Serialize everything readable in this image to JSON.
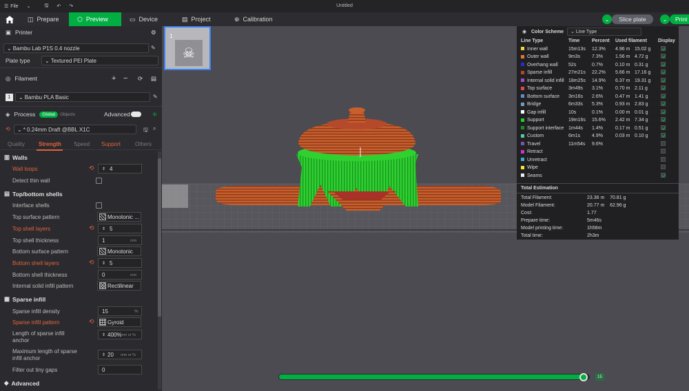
{
  "window": {
    "title": "Untitled",
    "file_menu": "File"
  },
  "nav": {
    "tabs": [
      {
        "label": "Prepare"
      },
      {
        "label": "Preview"
      },
      {
        "label": "Device"
      },
      {
        "label": "Project"
      },
      {
        "label": "Calibration"
      }
    ],
    "active": "Preview",
    "slice_label": "Slice plate",
    "print_label": "Print"
  },
  "printer": {
    "header": "Printer",
    "name": "Bambu Lab P1S 0.4 nozzle",
    "plate_type_label": "Plate type",
    "plate_type": "Textured PEI Plate"
  },
  "filament": {
    "header": "Filament",
    "slot": "1",
    "name": "Bambu PLA Basic"
  },
  "process": {
    "header": "Process",
    "global_label": "Global",
    "objects_label": "Objects",
    "advanced_label": "Advanced",
    "preset": "* 0.24mm Draft @BBL X1C",
    "tabs": [
      "Quality",
      "Strength",
      "Speed",
      "Support",
      "Others"
    ],
    "active_tab": "Strength"
  },
  "settings": {
    "walls": {
      "title": "Walls",
      "wall_loops_label": "Wall loops",
      "wall_loops": "4",
      "detect_thin_label": "Detect thin wall"
    },
    "topbottom": {
      "title": "Top/bottom shells",
      "interface_label": "Interface shells",
      "top_pattern_label": "Top surface pattern",
      "top_pattern": "Monotonic ...",
      "top_layers_label": "Top shell layers",
      "top_layers": "5",
      "top_thick_label": "Top shell thickness",
      "top_thick": "1",
      "bottom_pattern_label": "Bottom surface pattern",
      "bottom_pattern": "Monotonic",
      "bottom_layers_label": "Bottom shell layers",
      "bottom_layers": "5",
      "bottom_thick_label": "Bottom shell thickness",
      "bottom_thick": "0",
      "internal_label": "Internal solid infill pattern",
      "internal": "Rectilinear"
    },
    "sparse": {
      "title": "Sparse infill",
      "density_label": "Sparse infill density",
      "density": "15",
      "density_unit": "%",
      "pattern_label": "Sparse infill pattern",
      "pattern": "Gyroid",
      "length_label_1": "Length of sparse infill",
      "length_label_2": "anchor",
      "length": "400%",
      "length_unit": "mm or %",
      "maxlen_label_1": "Maximum length of sparse",
      "maxlen_label_2": "infill anchor",
      "maxlen": "20",
      "maxlen_unit": "mm or %",
      "filter_label": "Filter out tiny gaps",
      "filter": "0",
      "mm": "mm"
    },
    "advanced": {
      "title": "Advanced"
    }
  },
  "plate_thumb": {
    "number": "1"
  },
  "legend": {
    "scheme_label": "Color Scheme",
    "scheme_value": "Line Type",
    "headers": [
      "Line Type",
      "Time",
      "Percent",
      "Used filament",
      "Display"
    ],
    "rows": [
      {
        "name": "Inner wall",
        "color": "#f2d33a",
        "time": "15m13s",
        "pct": "12.3%",
        "len": "4.96 m",
        "wt": "15.02 g",
        "on": true
      },
      {
        "name": "Outer wall",
        "color": "#e6762e",
        "time": "9m3s",
        "pct": "7.3%",
        "len": "1.56 m",
        "wt": "4.72 g",
        "on": true
      },
      {
        "name": "Overhang wall",
        "color": "#2a2ad6",
        "time": "52s",
        "pct": "0.7%",
        "len": "0.10 m",
        "wt": "0.31 g",
        "on": true
      },
      {
        "name": "Sparse infill",
        "color": "#b5452f",
        "time": "27m21s",
        "pct": "22.2%",
        "len": "5.66 m",
        "wt": "17.16 g",
        "on": true
      },
      {
        "name": "Internal solid infill",
        "color": "#9c4fc9",
        "time": "18m25s",
        "pct": "14.9%",
        "len": "6.37 m",
        "wt": "19.31 g",
        "on": true
      },
      {
        "name": "Top surface",
        "color": "#e04848",
        "time": "3m49s",
        "pct": "3.1%",
        "len": "0.70 m",
        "wt": "2.11 g",
        "on": true
      },
      {
        "name": "Bottom surface",
        "color": "#5c8fc7",
        "time": "3m16s",
        "pct": "2.6%",
        "len": "0.47 m",
        "wt": "1.41 g",
        "on": true
      },
      {
        "name": "Bridge",
        "color": "#6fa0c4",
        "time": "6m33s",
        "pct": "5.3%",
        "len": "0.93 m",
        "wt": "2.83 g",
        "on": true
      },
      {
        "name": "Gap infill",
        "color": "#ffffff",
        "time": "10s",
        "pct": "0.1%",
        "len": "0.00 m",
        "wt": "0.01 g",
        "on": true
      },
      {
        "name": "Support",
        "color": "#1ed12e",
        "time": "19m16s",
        "pct": "15.6%",
        "len": "2.42 m",
        "wt": "7.34 g",
        "on": true
      },
      {
        "name": "Support interface",
        "color": "#1f8a24",
        "time": "1m44s",
        "pct": "1.4%",
        "len": "0.17 m",
        "wt": "0.51 g",
        "on": true
      },
      {
        "name": "Custom",
        "color": "#5cc8a0",
        "time": "6m1s",
        "pct": "4.9%",
        "len": "0.03 m",
        "wt": "0.10 g",
        "on": true
      },
      {
        "name": "Travel",
        "color": "#7a52b0",
        "time": "11m54s",
        "pct": "9.6%",
        "len": "",
        "wt": "",
        "on": false
      },
      {
        "name": "Retract",
        "color": "#cc33cc",
        "time": "",
        "pct": "",
        "len": "",
        "wt": "",
        "on": false
      },
      {
        "name": "Unretract",
        "color": "#3fa8d6",
        "time": "",
        "pct": "",
        "len": "",
        "wt": "",
        "on": false
      },
      {
        "name": "Wipe",
        "color": "#f2e83a",
        "time": "",
        "pct": "",
        "len": "",
        "wt": "",
        "on": false
      },
      {
        "name": "Seams",
        "color": "#ececec",
        "time": "",
        "pct": "",
        "len": "",
        "wt": "",
        "on": true
      }
    ],
    "total_title": "Total Estimation",
    "totals": [
      {
        "label": "Total Filament:",
        "value": "23.36 m    70.81 g"
      },
      {
        "label": "Model Filament:",
        "value": "20.77 m    62.96 g"
      },
      {
        "label": "Cost:",
        "value": "1.77"
      },
      {
        "label": "Prepare time:",
        "value": "5m46s"
      },
      {
        "label": "Model printing time:",
        "value": "1h58m"
      },
      {
        "label": "Total time:",
        "value": "2h3m"
      }
    ]
  },
  "layer_slider": {
    "value": "15",
    "progress": 0.985
  }
}
